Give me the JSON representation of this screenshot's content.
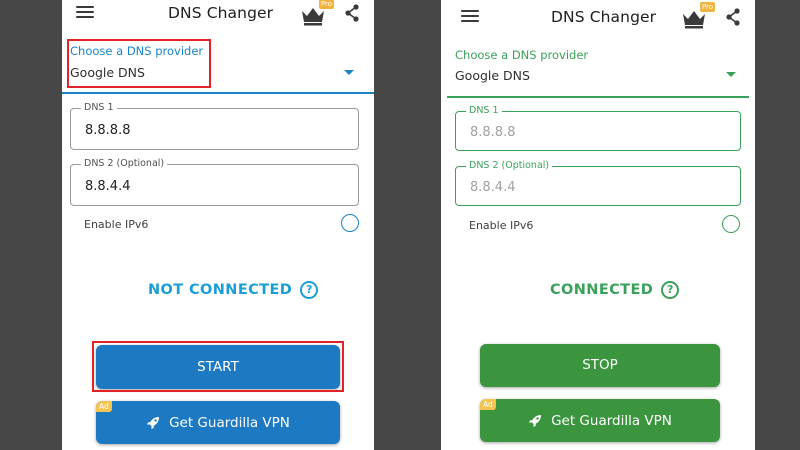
{
  "app_title": "DNS Changer",
  "pro_badge": "Pro",
  "provider": {
    "label": "Choose a DNS provider",
    "selected": "Google DNS"
  },
  "dns1": {
    "label": "DNS 1",
    "value": "8.8.8.8"
  },
  "dns2": {
    "label": "DNS 2 (Optional)",
    "value": "8.8.4.4"
  },
  "ipv6_label": "Enable IPv6",
  "ad_badge": "Ad",
  "vpn_button": "Get Guardilla VPN",
  "screens": {
    "disconnected": {
      "status": "NOT CONNECTED",
      "main_button": "START"
    },
    "connected": {
      "status": "CONNECTED",
      "main_button": "STOP"
    }
  },
  "help_glyph": "?",
  "colors": {
    "disconnected_accent": "#1a84c6",
    "connected_accent": "#3aa15a",
    "highlight": "#e2232a",
    "background": "#474747"
  },
  "icons": [
    "menu-icon",
    "crown-icon",
    "share-icon",
    "dropdown-arrow-icon",
    "help-icon",
    "rocket-icon"
  ]
}
